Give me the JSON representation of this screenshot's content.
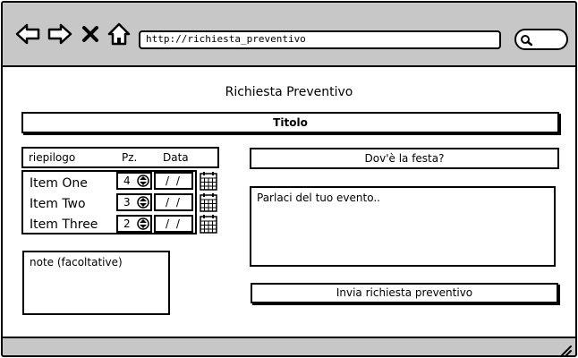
{
  "browser": {
    "url": "http://richiesta_preventivo"
  },
  "page": {
    "title": "Richiesta Preventivo",
    "heading_label": "Titolo"
  },
  "summary": {
    "header": {
      "col_name": "riepilogo",
      "col_qty": "Pz.",
      "col_date": "Data"
    },
    "items": [
      {
        "name": "Item One",
        "qty": "4",
        "date": "/ /"
      },
      {
        "name": "Item Two",
        "qty": "3",
        "date": "/ /"
      },
      {
        "name": "Item Three",
        "qty": "2",
        "date": "/ /"
      }
    ]
  },
  "notes": {
    "placeholder": "note (facoltative)"
  },
  "location": {
    "label": "Dov'è la festa?"
  },
  "event": {
    "placeholder": "Parlaci del tuo evento.."
  },
  "submit": {
    "label": "Invia richiesta preventivo"
  }
}
